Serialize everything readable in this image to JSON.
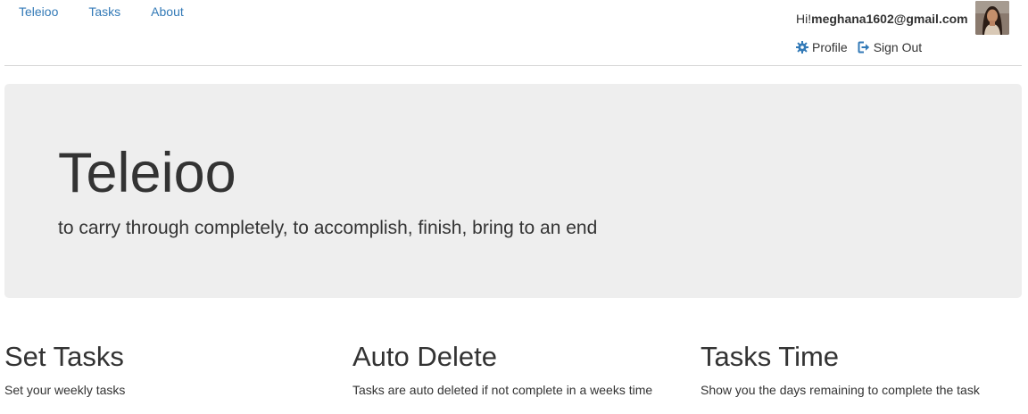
{
  "nav": {
    "links": [
      {
        "label": "Teleioo"
      },
      {
        "label": "Tasks"
      },
      {
        "label": "About"
      }
    ],
    "greeting": "Hi!",
    "email": "meghana1602@gmail.com",
    "profile_label": "Profile",
    "signout_label": "Sign Out",
    "link_color": "#337ab7"
  },
  "hero": {
    "title": "Teleioo",
    "subtitle": "to carry through completely, to accomplish, finish, bring to an end",
    "background": "#eeeeee"
  },
  "features": [
    {
      "title": "Set Tasks",
      "description": "Set your weekly tasks"
    },
    {
      "title": "Auto Delete",
      "description": "Tasks are auto deleted if not complete in a weeks time"
    },
    {
      "title": "Tasks Time",
      "description": "Show you the days remaining to complete the task"
    }
  ],
  "icons": {
    "profile": "gear-icon",
    "signout": "sign-out-icon"
  }
}
